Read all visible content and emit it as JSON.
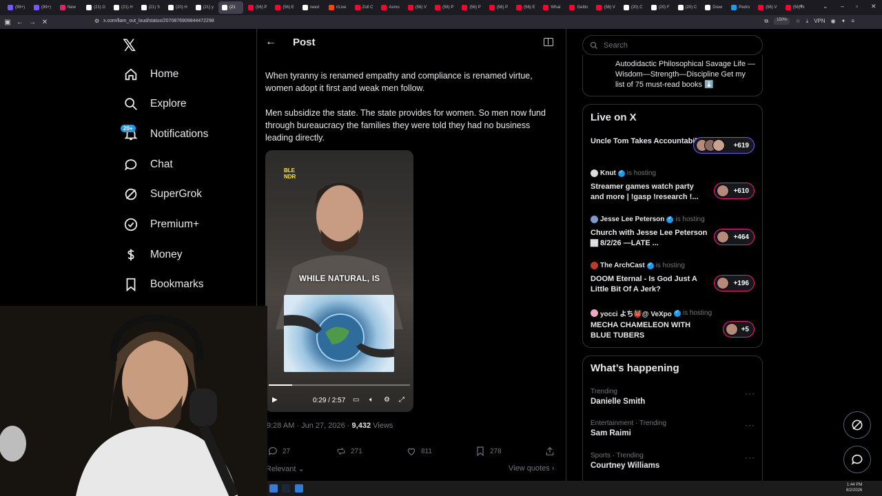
{
  "browser": {
    "tabs": [
      {
        "label": "(99+)",
        "color": "#7856ff"
      },
      {
        "label": "(99+)",
        "color": "#7856ff"
      },
      {
        "label": "New",
        "color": "#e0245e"
      },
      {
        "label": "(21) G",
        "color": "#ffffff"
      },
      {
        "label": "(21) H",
        "color": "#ffffff"
      },
      {
        "label": "(21) S",
        "color": "#ffffff"
      },
      {
        "label": "(20) H",
        "color": "#ffffff"
      },
      {
        "label": "(21) y",
        "color": "#ffffff"
      },
      {
        "label": "(21",
        "color": "#ffffff"
      },
      {
        "label": "(56) P",
        "color": "#ff0033"
      },
      {
        "label": "(56) E",
        "color": "#ff0033"
      },
      {
        "label": "need",
        "color": "#ffffff"
      },
      {
        "label": "r/Live",
        "color": "#ff4500"
      },
      {
        "label": "Zoll C",
        "color": "#ff0033"
      },
      {
        "label": "Asmo",
        "color": "#ff0033"
      },
      {
        "label": "(56) V",
        "color": "#ff0033"
      },
      {
        "label": "(56) P",
        "color": "#ff0033"
      },
      {
        "label": "(56) P",
        "color": "#ff0033"
      },
      {
        "label": "(56) P",
        "color": "#ff0033"
      },
      {
        "label": "(56) E",
        "color": "#ff0033"
      },
      {
        "label": "What",
        "color": "#ff0033"
      },
      {
        "label": "Gettin",
        "color": "#ff0033"
      },
      {
        "label": "(56) V",
        "color": "#ff0033"
      },
      {
        "label": "(20) C",
        "color": "#ffffff"
      },
      {
        "label": "(20) F",
        "color": "#ffffff"
      },
      {
        "label": "(20) C",
        "color": "#ffffff"
      },
      {
        "label": "Drew",
        "color": "#ffffff"
      },
      {
        "label": "Pedro",
        "color": "#1d9bf0"
      },
      {
        "label": "(56) V",
        "color": "#ff0033"
      },
      {
        "label": "(56) N",
        "color": "#ff0033"
      }
    ],
    "url": "x.com/liam_out_loud/status/2070876909844472298",
    "zoom": "150%",
    "vpn": "VPN"
  },
  "nav": {
    "items": [
      {
        "label": "Home",
        "icon": "home-icon"
      },
      {
        "label": "Explore",
        "icon": "search-icon"
      },
      {
        "label": "Notifications",
        "icon": "bell-icon"
      },
      {
        "label": "Chat",
        "icon": "chat-icon"
      },
      {
        "label": "SuperGrok",
        "icon": "grok-icon"
      },
      {
        "label": "Premium+",
        "icon": "premium-icon"
      },
      {
        "label": "Money",
        "icon": "money-icon"
      },
      {
        "label": "Bookmarks",
        "icon": "bookmark-icon"
      }
    ],
    "notifications_badge": "20+"
  },
  "post": {
    "header_title": "Post",
    "paragraph1": "When tyranny is renamed empathy and compliance is renamed virtue, women adopt it first and weak men follow.",
    "paragraph2": "Men subsidize the state. The state provides for women. So men now fund through bureaucracy the families they were told they had no business leading directly.",
    "video": {
      "brand": "BLE\nNDR",
      "caption": "WHILE NATURAL, IS",
      "timecode": "0:29 / 2:57",
      "progress_fraction": 0.164
    },
    "timestamp": "9:28 AM · Jun 27, 2026 · ",
    "views_count": "9,432",
    "views_label": " Views",
    "actions": {
      "replies": "27",
      "reposts": "271",
      "likes": "811",
      "bookmarks": "278"
    },
    "relevant_label": "Relevant",
    "view_quotes_label": "View quotes"
  },
  "right": {
    "search_placeholder": "Search",
    "promo_text": "Autodidactic Philosophical Savage Life —Wisdom—Strength—Discipline Get my list of 75 must-read books ⬇️",
    "live_title": "Live on X",
    "live": [
      {
        "host": "",
        "title": "Uncle Tom Takes Accountability",
        "count": "+619"
      },
      {
        "host": "Knut",
        "host_label": "is hosting",
        "title": "Streamer games watch party and more | !gasp !research !...",
        "count": "+610"
      },
      {
        "host": "Jesse Lee Peterson",
        "host_label": "is hosting",
        "title": "Church with Jesse Lee Peterson 🏾 8/2/26 —LATE ...",
        "count": "+464"
      },
      {
        "host": "The ArchCast",
        "host_label": "is hosting",
        "title": "DOOM Eternal - Is God Just A Little Bit Of A Jerk?",
        "count": "+196"
      },
      {
        "host": "yocci よち👹@ VeXpo",
        "host_label": "is hosting",
        "title": "MECHA CHAMELEON WITH BLUE TUBERS",
        "count": "+5"
      }
    ],
    "happening_title": "What’s happening",
    "trends": [
      {
        "meta": "Trending",
        "name": "Danielle Smith"
      },
      {
        "meta": "Entertainment · Trending",
        "name": "Sam Raimi"
      },
      {
        "meta": "Sports · Trending",
        "name": "Courtney Williams"
      }
    ]
  },
  "taskbar": {
    "time": "1:44 PM",
    "date": "8/2/2026"
  }
}
